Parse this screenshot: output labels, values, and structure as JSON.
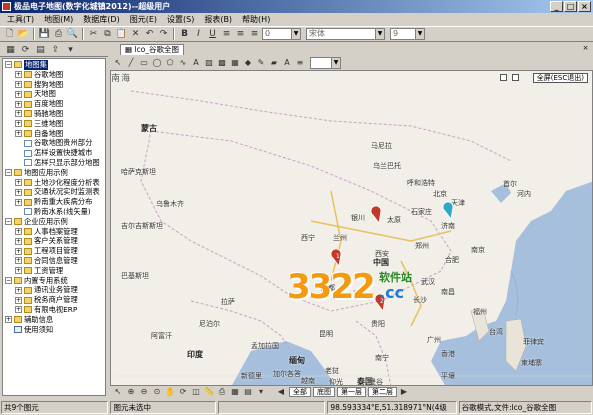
{
  "window": {
    "title": "极品电子地图(数字化城镇2012)--超级用户",
    "minimize_glyph": "_",
    "maximize_glyph": "□",
    "close_glyph": "×"
  },
  "menu": [
    "工具(T)",
    "地图(M)",
    "数据库(D)",
    "图元(E)",
    "设置(S)",
    "报表(B)",
    "帮助(H)"
  ],
  "toolbar": {
    "layer_combo": "0",
    "font_combo": "宋体",
    "size_combo": "9"
  },
  "tree": [
    {
      "level": 0,
      "exp": "−",
      "icon": "folder",
      "label": "地图集",
      "selected": true
    },
    {
      "level": 1,
      "exp": "+",
      "icon": "folder",
      "label": "谷歌地图"
    },
    {
      "level": 1,
      "exp": "+",
      "icon": "folder",
      "label": "搜狗地图"
    },
    {
      "level": 1,
      "exp": "+",
      "icon": "folder",
      "label": "天地图"
    },
    {
      "level": 1,
      "exp": "+",
      "icon": "folder",
      "label": "百度地图"
    },
    {
      "level": 1,
      "exp": "+",
      "icon": "folder",
      "label": "骑驰地图"
    },
    {
      "level": 1,
      "exp": "+",
      "icon": "folder",
      "label": "三维地图"
    },
    {
      "level": 1,
      "exp": "+",
      "icon": "folder",
      "label": "自备地图"
    },
    {
      "level": 1,
      "exp": "",
      "icon": "file",
      "label": "谷歌地图贵州部分"
    },
    {
      "level": 1,
      "exp": "",
      "icon": "file",
      "label": "怎样设置快捷城市"
    },
    {
      "level": 1,
      "exp": "",
      "icon": "file",
      "label": "怎样只显示部分地图"
    },
    {
      "level": 0,
      "exp": "−",
      "icon": "folder",
      "label": "地图应用示例"
    },
    {
      "level": 1,
      "exp": "+",
      "icon": "folder",
      "label": "土地沙化程度分析表"
    },
    {
      "level": 1,
      "exp": "+",
      "icon": "folder",
      "label": "交通状况实时监测表"
    },
    {
      "level": 1,
      "exp": "+",
      "icon": "folder",
      "label": "黔南重大疾病分布"
    },
    {
      "level": 1,
      "exp": "",
      "icon": "file",
      "label": "黔南水系(线矢量)"
    },
    {
      "level": 0,
      "exp": "−",
      "icon": "folder",
      "label": "企业应用示例"
    },
    {
      "level": 1,
      "exp": "+",
      "icon": "folder",
      "label": "人事档案管理"
    },
    {
      "level": 1,
      "exp": "+",
      "icon": "folder",
      "label": "客户关系管理"
    },
    {
      "level": 1,
      "exp": "+",
      "icon": "folder",
      "label": "工程项目管理"
    },
    {
      "level": 1,
      "exp": "+",
      "icon": "folder",
      "label": "合同信息管理"
    },
    {
      "level": 1,
      "exp": "+",
      "icon": "folder",
      "label": "工资管理"
    },
    {
      "level": 0,
      "exp": "−",
      "icon": "folder",
      "label": "内置专用系统"
    },
    {
      "level": 1,
      "exp": "+",
      "icon": "folder",
      "label": "通讯业务管理"
    },
    {
      "level": 1,
      "exp": "+",
      "icon": "folder",
      "label": "税务商户管理"
    },
    {
      "level": 1,
      "exp": "+",
      "icon": "folder",
      "label": "有限电视ERP"
    },
    {
      "level": 0,
      "exp": "+",
      "icon": "folder",
      "label": "辅助信息"
    },
    {
      "level": 0,
      "exp": "",
      "icon": "doc",
      "label": "使用须知"
    }
  ],
  "doc_tab": {
    "label": "lco_谷歌全图",
    "close": "×"
  },
  "map": {
    "fullscreen_button": "全屏(ESC退出)",
    "labels": [
      {
        "text": "乌鲁木齐",
        "cls": ""
      },
      {
        "text": "呼和浩特",
        "cls": ""
      },
      {
        "text": "北京",
        "cls": ""
      },
      {
        "text": "天津",
        "cls": ""
      },
      {
        "text": "石家庄",
        "cls": ""
      },
      {
        "text": "太原",
        "cls": ""
      },
      {
        "text": "济南",
        "cls": ""
      },
      {
        "text": "银川",
        "cls": ""
      },
      {
        "text": "兰州",
        "cls": ""
      },
      {
        "text": "西宁",
        "cls": ""
      },
      {
        "text": "西安",
        "cls": ""
      },
      {
        "text": "郑州",
        "cls": ""
      },
      {
        "text": "合肥",
        "cls": ""
      },
      {
        "text": "南京",
        "cls": ""
      },
      {
        "text": "武汉",
        "cls": ""
      },
      {
        "text": "成都",
        "cls": ""
      },
      {
        "text": "重庆",
        "cls": ""
      },
      {
        "text": "长沙",
        "cls": ""
      },
      {
        "text": "南昌",
        "cls": ""
      },
      {
        "text": "福州",
        "cls": ""
      },
      {
        "text": "贵阳",
        "cls": ""
      },
      {
        "text": "昆明",
        "cls": ""
      },
      {
        "text": "南宁",
        "cls": ""
      },
      {
        "text": "广州",
        "cls": ""
      },
      {
        "text": "香港",
        "cls": ""
      },
      {
        "text": "拉萨",
        "cls": ""
      },
      {
        "text": "中国",
        "cls": "country"
      },
      {
        "text": "台湾",
        "cls": ""
      },
      {
        "text": "尼泊尔",
        "cls": ""
      },
      {
        "text": "印度",
        "cls": "country"
      },
      {
        "text": "孟加拉国",
        "cls": ""
      },
      {
        "text": "缅甸",
        "cls": "country"
      },
      {
        "text": "老挝",
        "cls": ""
      },
      {
        "text": "越南",
        "cls": ""
      },
      {
        "text": "泰国",
        "cls": "country"
      },
      {
        "text": "柬埔寨",
        "cls": ""
      },
      {
        "text": "菲律宾",
        "cls": ""
      },
      {
        "text": "马尼拉",
        "cls": ""
      },
      {
        "text": "乌兰巴托",
        "cls": ""
      },
      {
        "text": "蒙古",
        "cls": "country"
      },
      {
        "text": "哈萨克斯坦",
        "cls": ""
      },
      {
        "text": "吉尔吉斯斯坦",
        "cls": ""
      },
      {
        "text": "巴基斯坦",
        "cls": ""
      },
      {
        "text": "阿富汗",
        "cls": ""
      },
      {
        "text": "新德里",
        "cls": ""
      },
      {
        "text": "加尔各答",
        "cls": ""
      },
      {
        "text": "仰光",
        "cls": ""
      },
      {
        "text": "曼谷",
        "cls": ""
      },
      {
        "text": "河内",
        "cls": ""
      },
      {
        "text": "首尔",
        "cls": ""
      },
      {
        "text": "平壤",
        "cls": ""
      },
      {
        "text": "南海",
        "cls": "big"
      }
    ],
    "markers": [
      {
        "label": "1",
        "color": "#c0392b"
      },
      {
        "label": "2",
        "color": "#c0392b"
      },
      {
        "label": "",
        "color": "#c0392b"
      },
      {
        "label": "",
        "color": "#2fa8c8"
      }
    ]
  },
  "watermark": {
    "number": "3322",
    "cn": "软件站",
    "domain": ".cc"
  },
  "bottom_tabs": [
    "全部",
    "底图",
    "第一层",
    "第二层"
  ],
  "status": {
    "count": "共9个图元",
    "selection": "图元未选中",
    "coords": "98.593334°E,51.318971°N(4级",
    "mode": "谷歌模式,文件:lco_谷歌全图"
  },
  "colors": {
    "title_start": "#0a246a",
    "title_end": "#a6caf0",
    "water": "#a5bfdd",
    "land": "#f2efe8",
    "selection": "#0a246a"
  }
}
